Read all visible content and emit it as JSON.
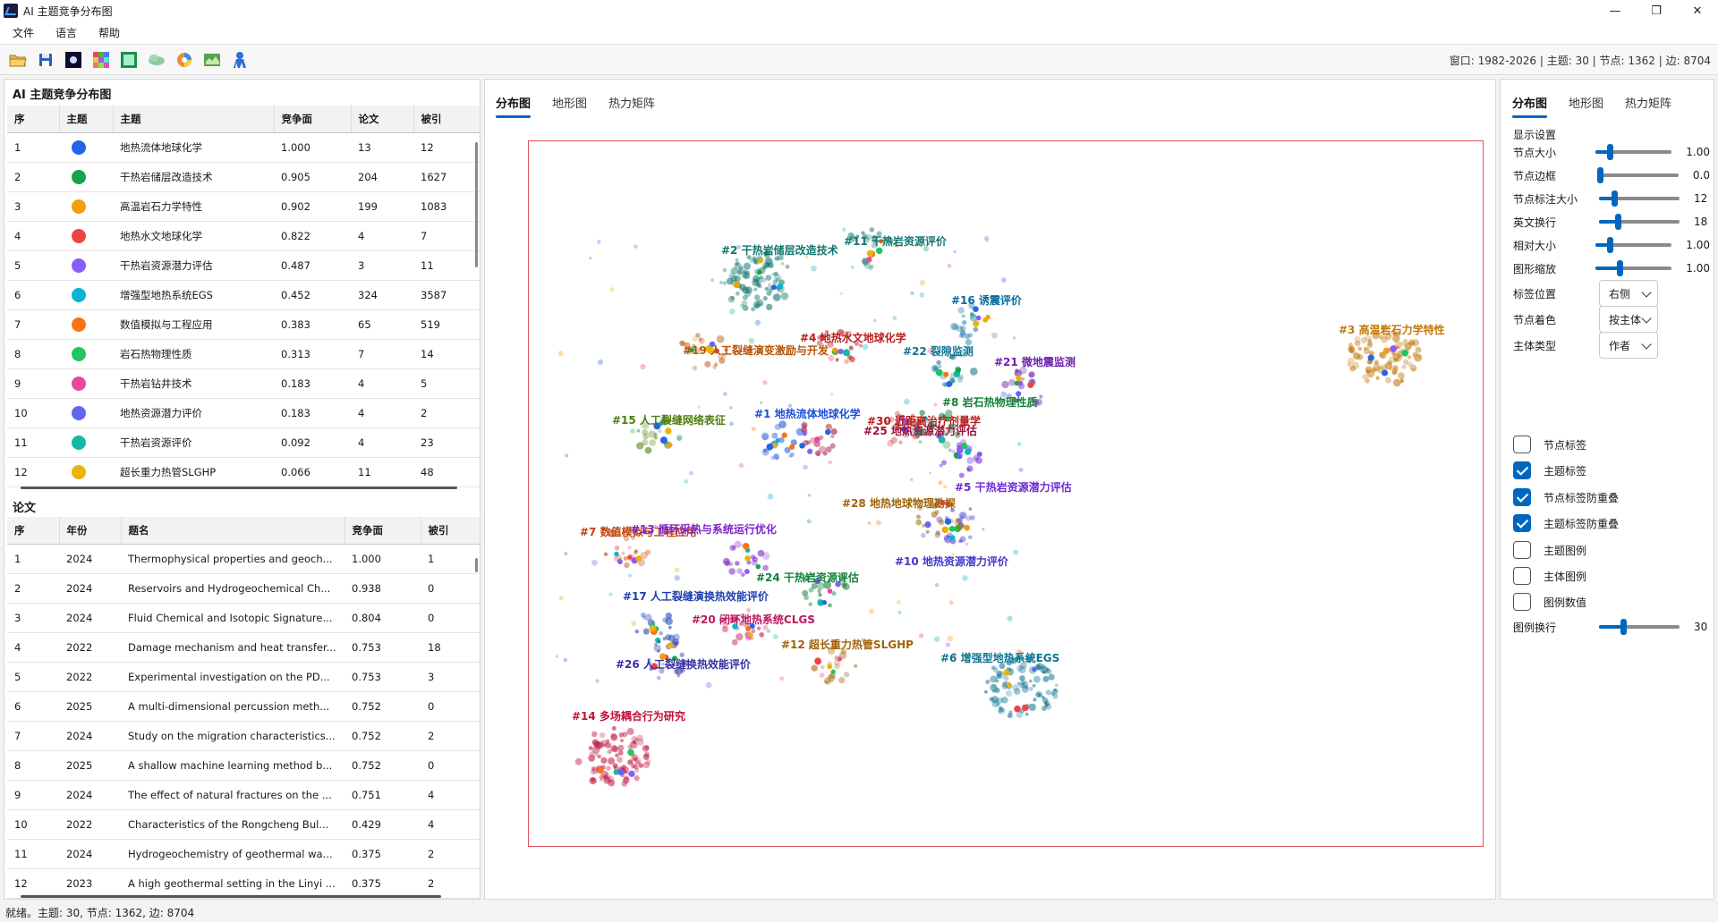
{
  "window": {
    "title": "AI 主题竞争分布图",
    "controls": [
      "—",
      "❐",
      "✕"
    ]
  },
  "menu": [
    "文件",
    "语言",
    "帮助"
  ],
  "toolbar": {
    "icons": [
      "open-folder-icon",
      "save-icon",
      "dark-theme-icon",
      "palette-grid-icon",
      "image-export-icon",
      "cloud-icon",
      "color-wheel-icon",
      "map-export-icon",
      "user-icon"
    ],
    "status": "窗口: 1982-2026 | 主题: 30 | 节点: 1362 | 边: 8704"
  },
  "topics_panel": {
    "title": "AI 主题竞争分布图",
    "columns": [
      "序",
      "主题",
      "主题",
      "竞争面",
      "论文",
      "被引"
    ],
    "rows": [
      {
        "idx": "1",
        "color": "#2563eb",
        "name": "地热流体地球化学",
        "score": "1.000",
        "papers": "13",
        "cites": "12"
      },
      {
        "idx": "2",
        "color": "#16a34a",
        "name": "干热岩储层改造技术",
        "score": "0.905",
        "papers": "204",
        "cites": "1627"
      },
      {
        "idx": "3",
        "color": "#f59e0b",
        "name": "高温岩石力学特性",
        "score": "0.902",
        "papers": "199",
        "cites": "1083"
      },
      {
        "idx": "4",
        "color": "#ef4444",
        "name": "地热水文地球化学",
        "score": "0.822",
        "papers": "4",
        "cites": "7"
      },
      {
        "idx": "5",
        "color": "#8b5cf6",
        "name": "干热岩资源潜力评估",
        "score": "0.487",
        "papers": "3",
        "cites": "11"
      },
      {
        "idx": "6",
        "color": "#06b6d4",
        "name": "增强型地热系统EGS",
        "score": "0.452",
        "papers": "324",
        "cites": "3587"
      },
      {
        "idx": "7",
        "color": "#f97316",
        "name": "数值模拟与工程应用",
        "score": "0.383",
        "papers": "65",
        "cites": "519"
      },
      {
        "idx": "8",
        "color": "#22c55e",
        "name": "岩石热物理性质",
        "score": "0.313",
        "papers": "7",
        "cites": "14"
      },
      {
        "idx": "9",
        "color": "#ec4899",
        "name": "干热岩钻井技术",
        "score": "0.183",
        "papers": "4",
        "cites": "5"
      },
      {
        "idx": "10",
        "color": "#6366f1",
        "name": "地热资源潜力评价",
        "score": "0.183",
        "papers": "4",
        "cites": "2"
      },
      {
        "idx": "11",
        "color": "#14b8a6",
        "name": "干热岩资源评价",
        "score": "0.092",
        "papers": "4",
        "cites": "23"
      },
      {
        "idx": "12",
        "color": "#eab308",
        "name": "超长重力热管SLGHP",
        "score": "0.066",
        "papers": "11",
        "cites": "48"
      }
    ]
  },
  "papers_panel": {
    "title": "论文",
    "columns": [
      "序",
      "年份",
      "题名",
      "竞争面",
      "被引"
    ],
    "rows": [
      {
        "idx": "1",
        "year": "2024",
        "title": "Thermophysical properties and geoch...",
        "score": "1.000",
        "cites": "1"
      },
      {
        "idx": "2",
        "year": "2024",
        "title": "Reservoirs and Hydrogeochemical Ch...",
        "score": "0.938",
        "cites": "0"
      },
      {
        "idx": "3",
        "year": "2024",
        "title": "Fluid Chemical and Isotopic Signature...",
        "score": "0.804",
        "cites": "0"
      },
      {
        "idx": "4",
        "year": "2022",
        "title": "Damage mechanism and heat transfer...",
        "score": "0.753",
        "cites": "18"
      },
      {
        "idx": "5",
        "year": "2022",
        "title": "Experimental investigation on the PD...",
        "score": "0.753",
        "cites": "3"
      },
      {
        "idx": "6",
        "year": "2025",
        "title": "A multi-dimensional percussion meth...",
        "score": "0.752",
        "cites": "0"
      },
      {
        "idx": "7",
        "year": "2024",
        "title": "Study on the migration characteristics...",
        "score": "0.752",
        "cites": "2"
      },
      {
        "idx": "8",
        "year": "2025",
        "title": "A shallow machine learning method b...",
        "score": "0.752",
        "cites": "0"
      },
      {
        "idx": "9",
        "year": "2024",
        "title": "The effect of natural fractures on the ...",
        "score": "0.751",
        "cites": "4"
      },
      {
        "idx": "10",
        "year": "2022",
        "title": "Characteristics of the Rongcheng Bul...",
        "score": "0.429",
        "cites": "4"
      },
      {
        "idx": "11",
        "year": "2024",
        "title": "Hydrogeochemistry of geothermal wa...",
        "score": "0.375",
        "cites": "2"
      },
      {
        "idx": "12",
        "year": "2023",
        "title": "A high geothermal setting in the Linyi ...",
        "score": "0.375",
        "cites": "2"
      }
    ]
  },
  "center_tabs": [
    "分布图",
    "地形图",
    "热力矩阵"
  ],
  "map": {
    "clusters": [
      {
        "label": "#1 地热流体地球化学",
        "color": "#1d4ed8"
      },
      {
        "label": "#2 干热岩储层改造技术",
        "color": "#0f766e"
      },
      {
        "label": "#3 高温岩石力学特性",
        "color": "#c2790a"
      },
      {
        "label": "#4 地热水文地球化学",
        "color": "#b91c1c"
      },
      {
        "label": "#5 干热岩资源潜力评估",
        "color": "#6d28d9"
      },
      {
        "label": "#6 增强型地热系统EGS",
        "color": "#0e7490"
      },
      {
        "label": "#7 数值模拟与工程应用",
        "color": "#c2410c"
      },
      {
        "label": "#8 岩石热物理性质",
        "color": "#15803d"
      },
      {
        "label": "#10 地热资源潜力评价",
        "color": "#4338ca"
      },
      {
        "label": "#11 干热岩资源评价",
        "color": "#0f766e"
      },
      {
        "label": "#12 超长重力热管SLGHP",
        "color": "#a16207"
      },
      {
        "label": "#13 循环采热与系统运行优化",
        "color": "#7e22ce"
      },
      {
        "label": "#14 多场耦合行为研究",
        "color": "#be123c"
      },
      {
        "label": "#15 人工裂缝网络表征",
        "color": "#4d7c0f"
      },
      {
        "label": "#16 诱震评价",
        "color": "#0369a1"
      },
      {
        "label": "#17 人工裂缝演换热效能评价",
        "color": "#1e40af"
      },
      {
        "label": "#19 人工裂缝演变激励与开发",
        "color": "#b45309"
      },
      {
        "label": "#20 闭环地热系统CLGS",
        "color": "#be185d"
      },
      {
        "label": "#21 微地震监测",
        "color": "#6b21a8"
      },
      {
        "label": "#22 裂隙监测",
        "color": "#0e7490"
      },
      {
        "label": "#24 干热岩资源评估",
        "color": "#15803d"
      },
      {
        "label": "#25 地热资源潜力评估",
        "color": "#9f1239"
      },
      {
        "label": "#26 人工裂缝换热效能评价",
        "color": "#3730a3"
      },
      {
        "label": "#28 地热地球物理勘探",
        "color": "#a16207"
      },
      {
        "label": "#30 近距离治疗剂量学",
        "color": "#b91c1c"
      }
    ]
  },
  "right_tabs": [
    "分布图",
    "地形图",
    "热力矩阵"
  ],
  "settings": {
    "section_title": "显示设置",
    "sliders": [
      {
        "label": "节点大小",
        "value": "1.00",
        "pct": 0.18
      },
      {
        "label": "节点边框",
        "value": "0.0",
        "pct": 0.02
      },
      {
        "label": "节点标注大小",
        "value": "12",
        "pct": 0.19
      },
      {
        "label": "英文换行",
        "value": "18",
        "pct": 0.23
      },
      {
        "label": "相对大小",
        "value": "1.00",
        "pct": 0.18
      },
      {
        "label": "图形缩放",
        "value": "1.00",
        "pct": 0.3
      }
    ],
    "selects": [
      {
        "label": "标签位置",
        "value": "右侧"
      },
      {
        "label": "节点着色",
        "value": "按主体"
      },
      {
        "label": "主体类型",
        "value": "作者"
      }
    ],
    "checkboxes": [
      {
        "label": "节点标签",
        "checked": false
      },
      {
        "label": "主题标签",
        "checked": true
      },
      {
        "label": "节点标签防重叠",
        "checked": true
      },
      {
        "label": "主题标签防重叠",
        "checked": true
      },
      {
        "label": "主题图例",
        "checked": false
      },
      {
        "label": "主体图例",
        "checked": false
      },
      {
        "label": "图例数值",
        "checked": false
      }
    ],
    "legend_wrap": {
      "label": "图例换行",
      "value": "30",
      "pct": 0.3
    }
  },
  "statusbar": "就绪。主题: 30, 节点: 1362, 边: 8704"
}
